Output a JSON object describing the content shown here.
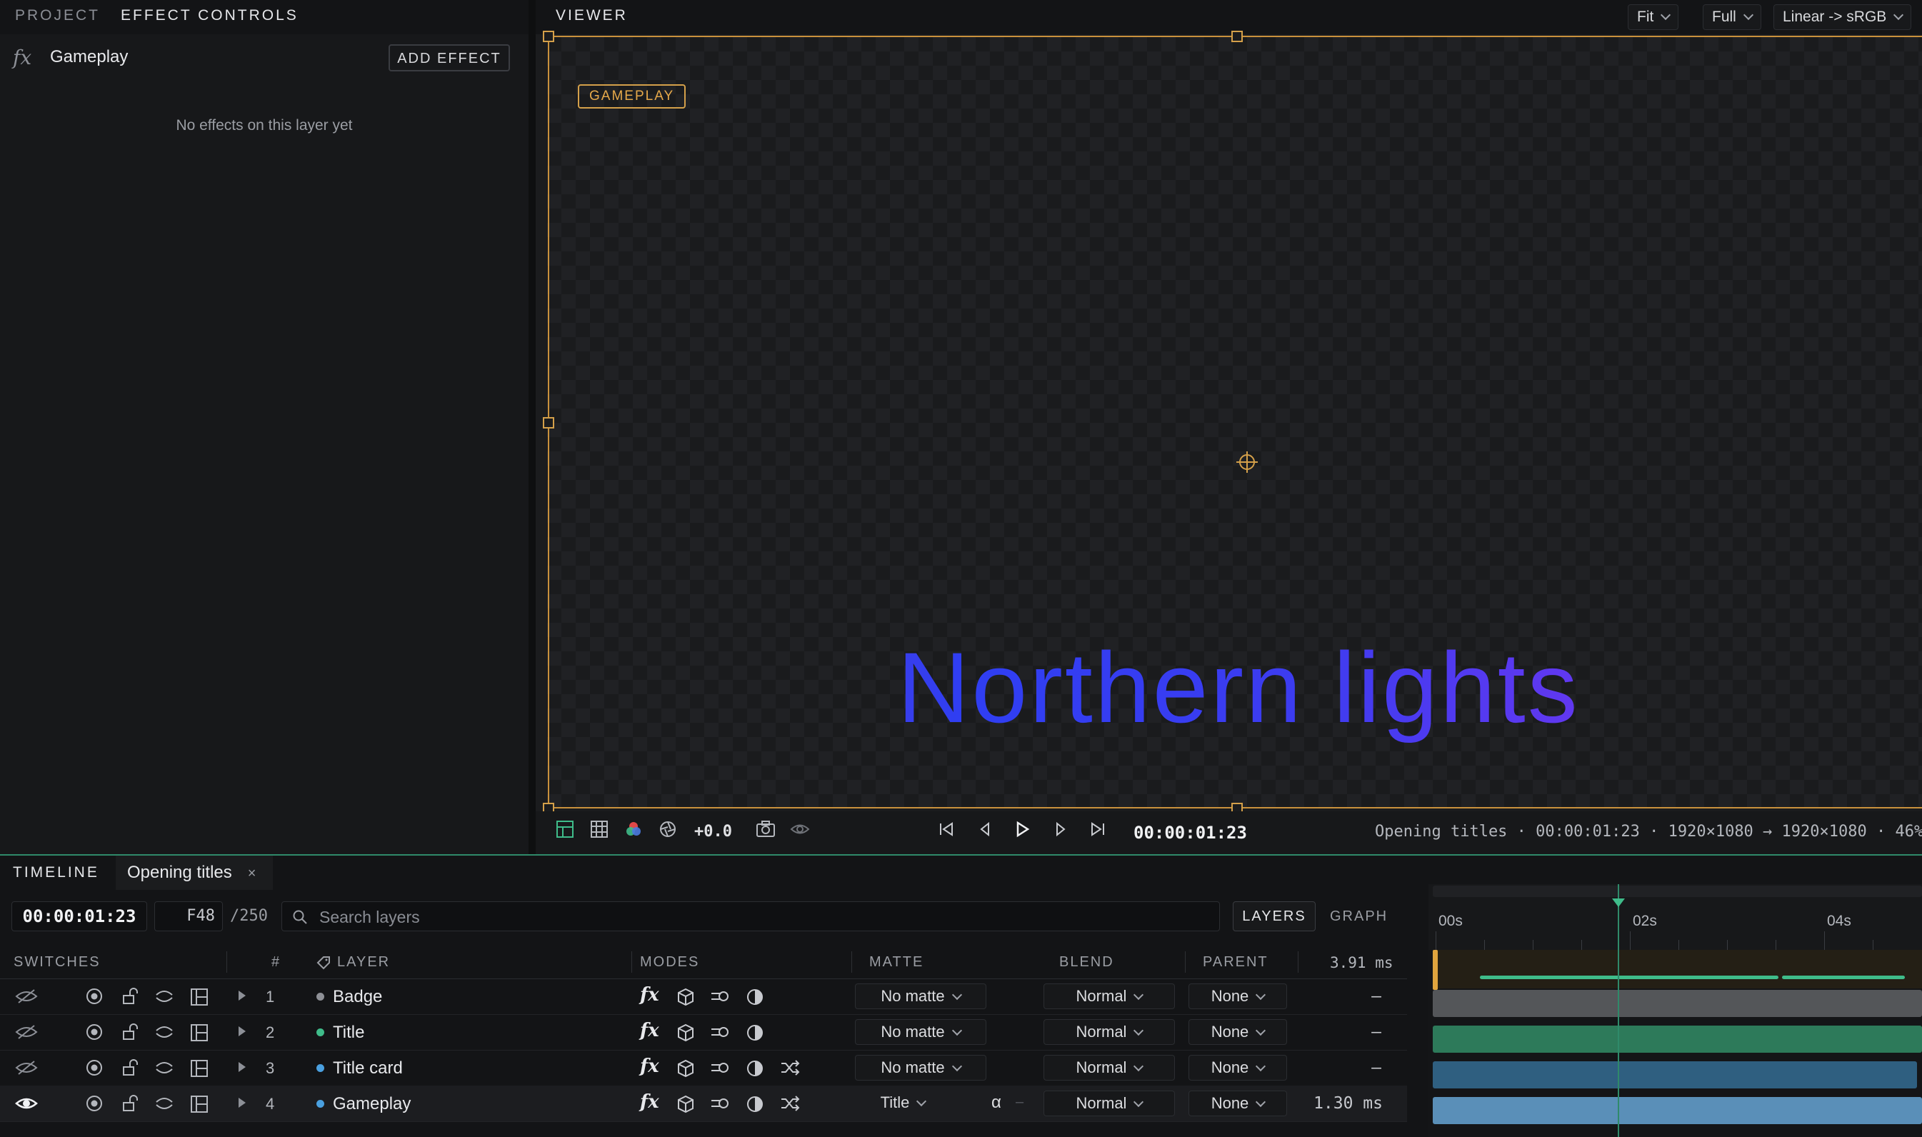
{
  "left_panel": {
    "tab_project": "PROJECT",
    "tab_effect_controls": "EFFECT CONTROLS",
    "fx_glyph": "fx",
    "layer_name": "Gameplay",
    "add_effect": "ADD EFFECT",
    "empty_text": "No effects on this layer yet"
  },
  "viewer": {
    "title": "VIEWER",
    "zoom": "Fit",
    "resolution": "Full",
    "color_transform": "Linear -> sRGB",
    "layer_badge": "GAMEPLAY",
    "canvas_text": "Northern lights",
    "exposure": "+0.0",
    "timecode": "00:00:01:23",
    "status": "Opening titles · 00:00:01:23 · 1920×1080 → 1920×1080 · 46%"
  },
  "timeline": {
    "tab": "TIMELINE",
    "comp_tab": "Opening titles",
    "close": "×",
    "timecode": "00:00:01:23",
    "frame": "F48",
    "frame_total": "/250",
    "search_placeholder": "Search layers",
    "layers_btn": "LAYERS",
    "graph_btn": "GRAPH",
    "columns": {
      "switches": "SWITCHES",
      "num": "#",
      "layer": "LAYER",
      "modes": "MODES",
      "matte": "MATTE",
      "blend": "BLEND",
      "parent": "PARENT",
      "total_time": "3.91 ms"
    },
    "ruler": [
      "00s",
      "02s",
      "04s"
    ],
    "layers": [
      {
        "num": "1",
        "name": "Badge",
        "color": "#8e9096",
        "matte": "No matte",
        "blend": "Normal",
        "parent": "None",
        "time": "–",
        "visible": false
      },
      {
        "num": "2",
        "name": "Title",
        "color": "#3fbc8a",
        "matte": "No matte",
        "blend": "Normal",
        "parent": "None",
        "time": "–",
        "visible": false
      },
      {
        "num": "3",
        "name": "Title card",
        "color": "#4aa0e0",
        "matte": "No matte",
        "blend": "Normal",
        "parent": "None",
        "time": "–",
        "visible": false
      },
      {
        "num": "4",
        "name": "Gameplay",
        "color": "#4aa0e0",
        "matte": "Title",
        "matte_mode": "α",
        "matte_dash": "–",
        "blend": "Normal",
        "parent": "None",
        "time": "1.30 ms",
        "visible": true
      }
    ]
  },
  "colors": {
    "accent_orange": "#d4a04a",
    "accent_green": "#3fbc8a",
    "bar_badge": "#545659",
    "bar_title": "#2d7a5a",
    "bar_titlecard": "#2f5f80",
    "bar_gameplay": "#5a8fb8"
  }
}
